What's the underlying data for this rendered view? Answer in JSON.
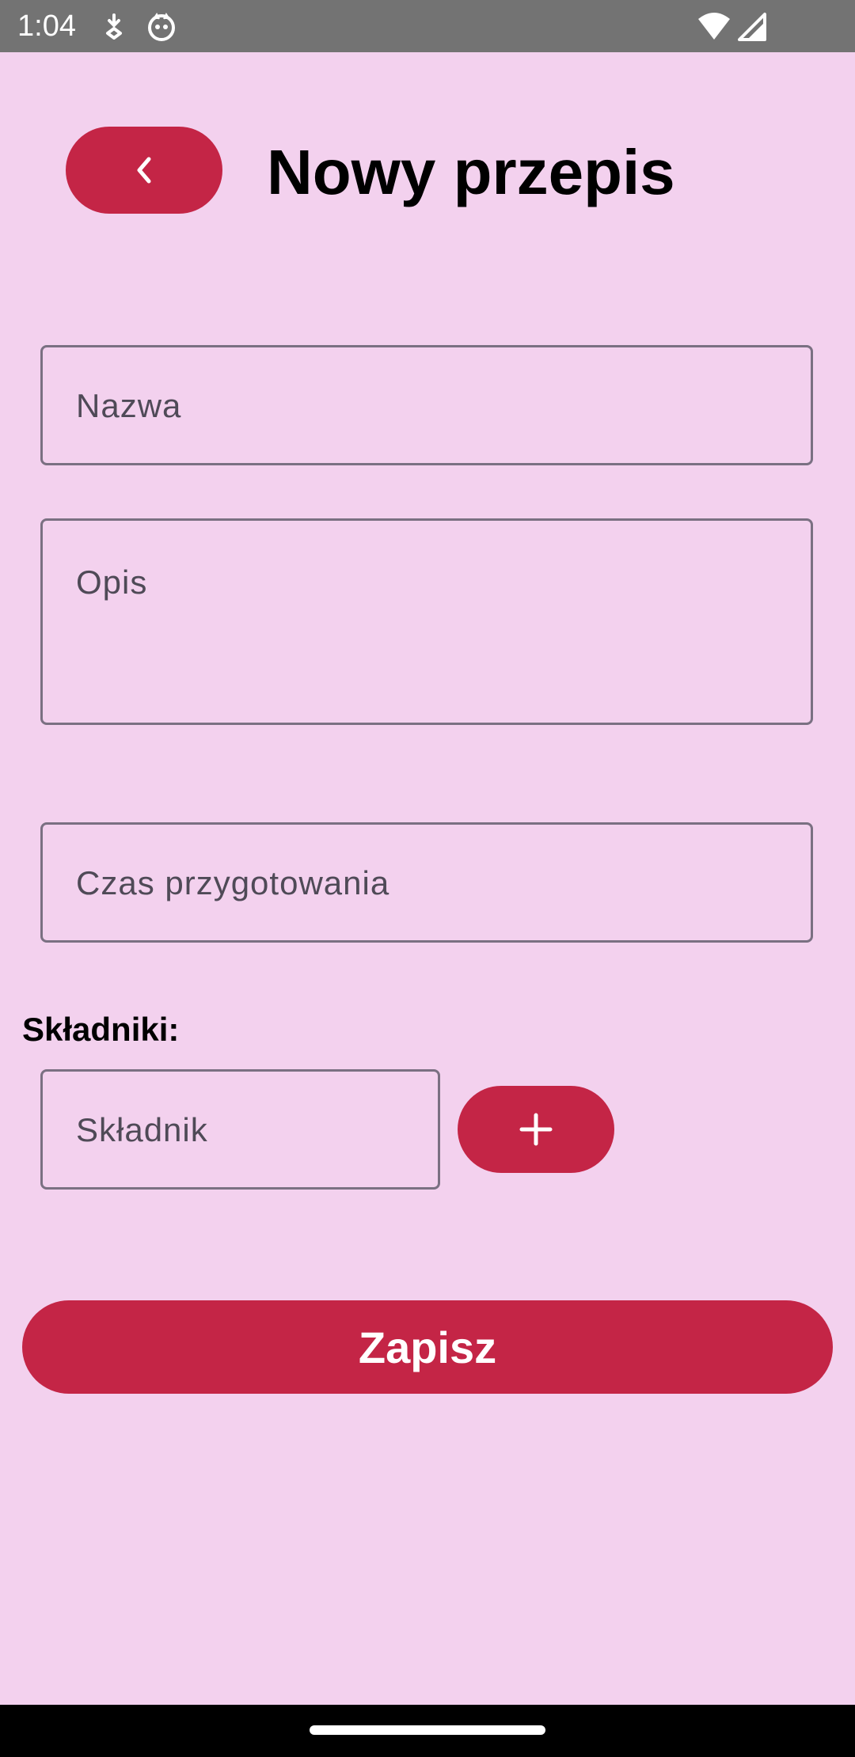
{
  "status_bar": {
    "time": "1:04",
    "left_icons": [
      "download-status-icon",
      "cat-app-icon"
    ],
    "right_icons": [
      "wifi-icon",
      "signal-icon"
    ]
  },
  "header": {
    "back_icon": "chevron-left-icon",
    "title": "Nowy przepis"
  },
  "form": {
    "name_placeholder": "Nazwa",
    "description_placeholder": "Opis",
    "prep_time_placeholder": "Czas przygotowania",
    "ingredients_label": "Składniki:",
    "ingredient_placeholder": "Składnik",
    "add_icon": "plus-icon",
    "save_label": "Zapisz"
  },
  "colors": {
    "background": "#f3d1ee",
    "accent": "#c42546",
    "status_bar": "#737373",
    "field_border": "#7a7082"
  }
}
